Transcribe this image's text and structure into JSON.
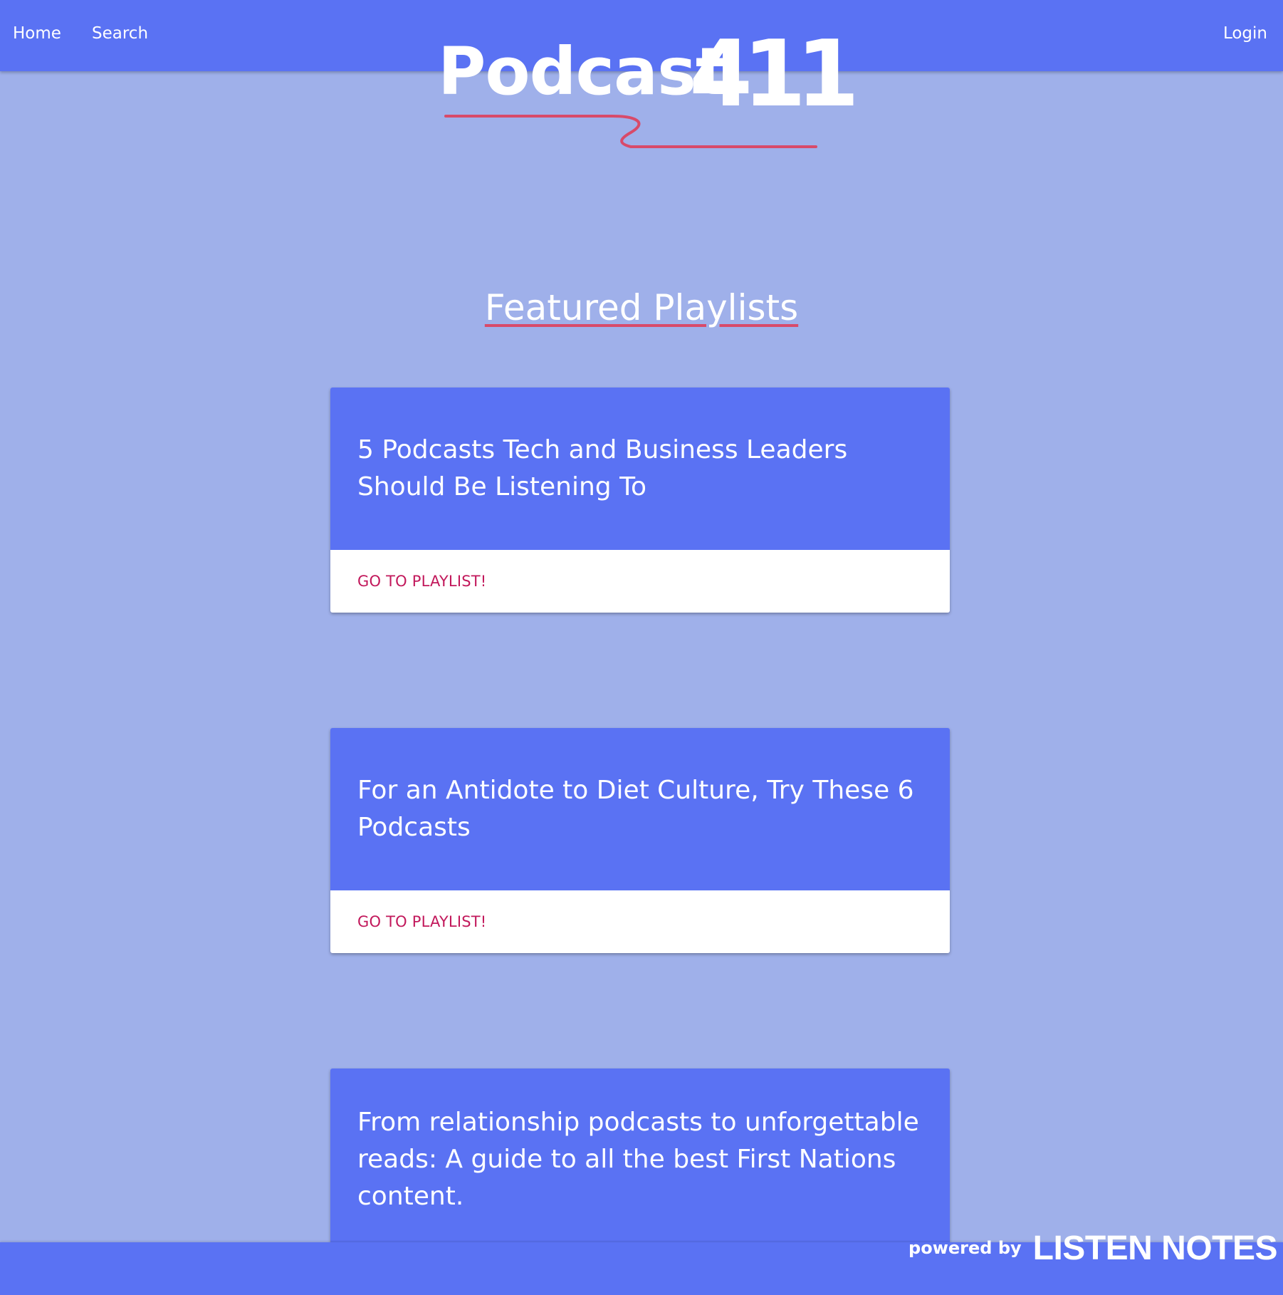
{
  "nav": {
    "home": "Home",
    "search": "Search",
    "login": "Login"
  },
  "logo": {
    "word": "Podcast",
    "number": "411"
  },
  "section": {
    "title": "Featured Playlists"
  },
  "playlists": [
    {
      "title": "5 Podcasts Tech and Business Leaders Should Be Listening To",
      "action": "GO TO PLAYLIST!"
    },
    {
      "title": "For an Antidote to Diet Culture, Try These 6 Podcasts",
      "action": "GO TO PLAYLIST!"
    },
    {
      "title": "From relationship podcasts to unforgettable reads: A guide to all the best First Nations content."
    }
  ],
  "footer": {
    "powered_by": "powered by",
    "brand": "LISTEN NOTES"
  },
  "colors": {
    "page_background": "#9fb0ea",
    "primary": "#5a72f3",
    "accent_link": "#c2185b",
    "underline": "#d84a6a"
  }
}
